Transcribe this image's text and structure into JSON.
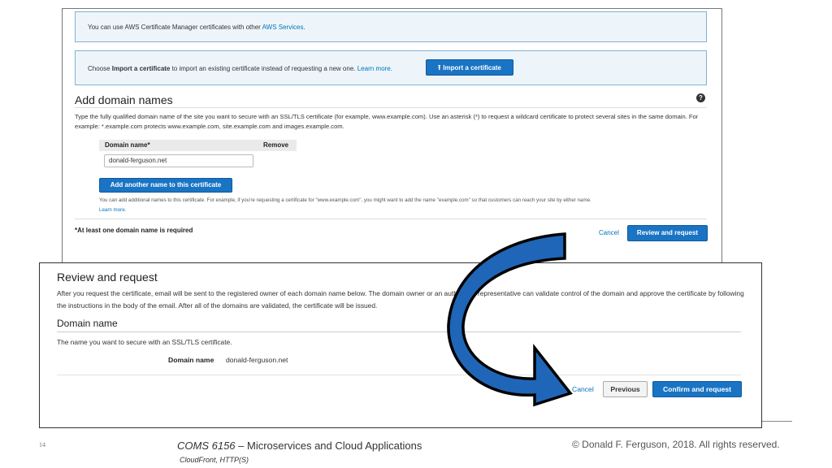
{
  "top": {
    "info1": {
      "text": "You can use AWS Certificate Manager certificates with other ",
      "link": "AWS Services",
      "suffix": "."
    },
    "info2": {
      "text_before": "Choose ",
      "bold": "Import a certificate",
      "text_after": " to import an existing certificate instead of requesting a new one. ",
      "link": "Learn more.",
      "button_label": "Import a certificate",
      "button_icon": "upload-icon"
    },
    "add_domain": {
      "title": "Add domain names",
      "help_icon": "?",
      "description": "Type the fully qualified domain name of the site you want to secure with an SSL/TLS certificate (for example, www.example.com). Use an asterisk (*) to request a wildcard certificate to protect several sites in the same domain. For example: *.example.com protects www.example.com, site.example.com and images.example.com.",
      "col_domain": "Domain name*",
      "col_remove": "Remove",
      "domain_value": "donald-ferguson.net",
      "add_button": "Add another name to this certificate",
      "hint": "You can add additional names to this certificate. For example, if you're requesting a certificate for \"www.example.com\", you might want to add the name \"example.com\" so that customers can reach your site by either name.",
      "learn_more": "Learn more.",
      "required_note": "*At least one domain name is required",
      "cancel": "Cancel",
      "review_button": "Review and request"
    }
  },
  "bottom": {
    "title": "Review and request",
    "description": "After you request the certificate, email will be sent to the registered owner of each domain name below. The domain owner or an authorized representative can validate control of the domain and approve the certificate by following the instructions in the body of the email. After all of the domains are validated, the certificate will be issued.",
    "domain_section_title": "Domain name",
    "domain_section_desc": "The name you want to secure with an SSL/TLS certificate.",
    "domain_label": "Domain name",
    "domain_value": "donald-ferguson.net",
    "cancel": "Cancel",
    "previous": "Previous",
    "confirm": "Confirm and request"
  },
  "arrow": {
    "color": "#1f66b8",
    "icon": "curved-arrow-icon"
  },
  "footer": {
    "slide_number": "14",
    "course_code": "COMS 6156",
    "course_rest": " – Microservices and Cloud Applications",
    "topic": "CloudFront, HTTP(S)",
    "copyright": "© Donald F. Ferguson, 2018. All rights reserved."
  }
}
